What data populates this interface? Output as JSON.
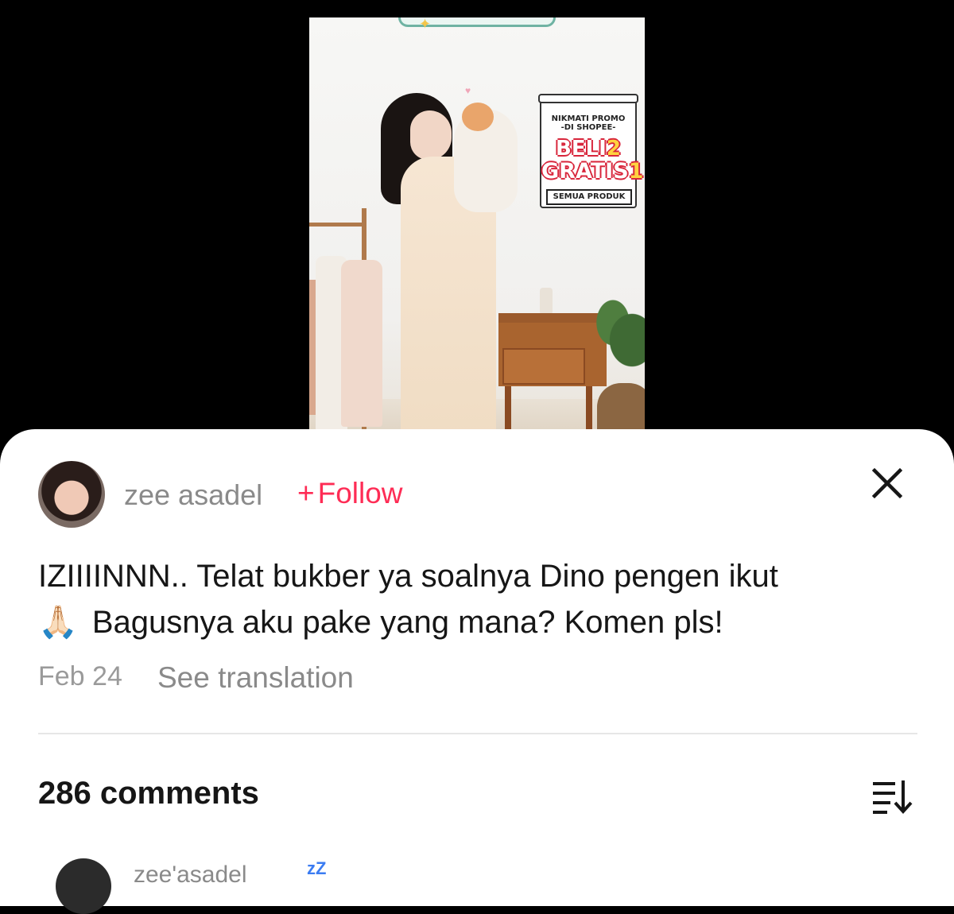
{
  "video": {
    "promo": {
      "line1": "NIKMATI PROMO",
      "line2": "-DI SHOPEE-",
      "big_word1": "BELI",
      "big_num1": "2",
      "big_word2": "GRATIS",
      "big_num2": "1",
      "footer": "SEMUA PRODUK"
    }
  },
  "post": {
    "username": "zee asadel",
    "follow_label": "Follow",
    "caption_line1": "IZIIIINNN.. Telat bukber ya soalnya Dino pengen ikut",
    "caption_emoji": "🙏🏻",
    "caption_line2": "Bagusnya aku pake yang mana? Komen pls!",
    "date": "Feb 24",
    "translate_label": "See translation"
  },
  "comments": {
    "count_label": "286 comments",
    "first_user": "zee'asadel",
    "first_badge": "zZ"
  },
  "colors": {
    "accent": "#fe2c55",
    "text": "#161616",
    "muted": "#8a8a8a"
  },
  "icons": {
    "close": "close-icon",
    "sort": "sort-icon",
    "pray": "folded-hands-emoji"
  }
}
